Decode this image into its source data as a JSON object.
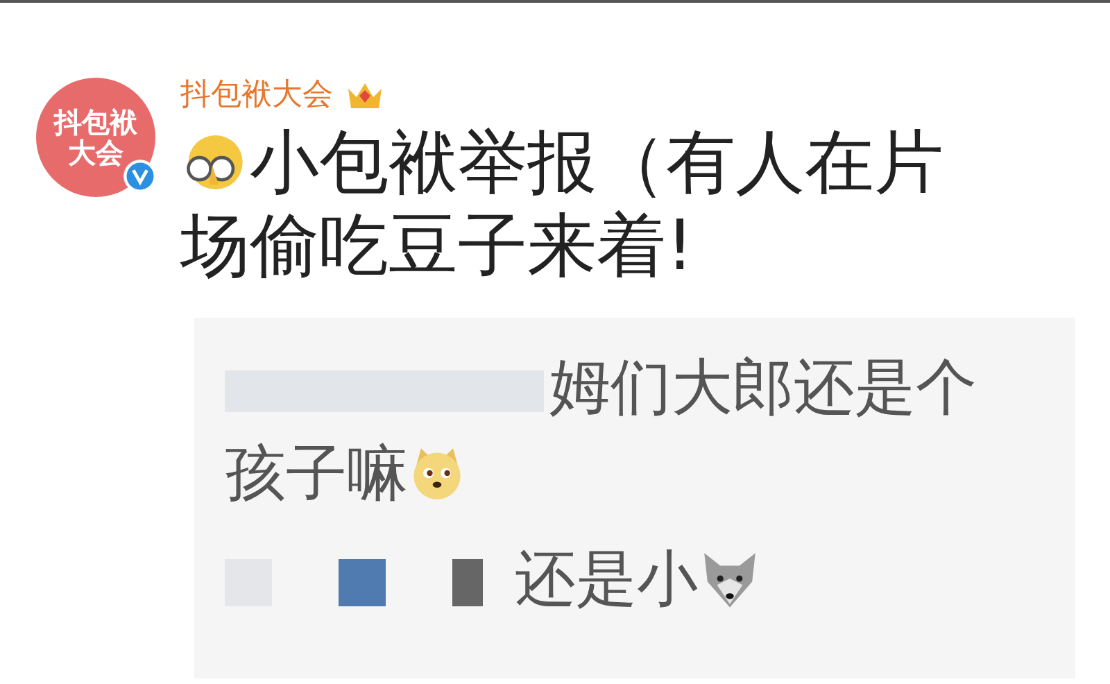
{
  "post": {
    "avatar_text": "抖包袱大会",
    "verified": true,
    "author": "抖包袱大会",
    "text": "小包袱举报（有人在片场偷吃豆子来着!"
  },
  "comments": [
    {
      "text": "姆们大郎还是个孩子嘛",
      "kind": "doge"
    },
    {
      "text": "还是小",
      "kind": "wolf"
    }
  ]
}
